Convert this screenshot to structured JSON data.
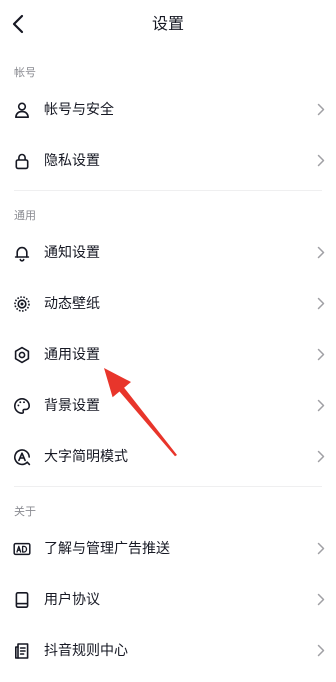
{
  "header": {
    "title": "设置",
    "back_icon": "chevron-left-icon"
  },
  "sections": [
    {
      "label": "帐号",
      "items": [
        {
          "label": "帐号与安全",
          "icon": "user-icon"
        },
        {
          "label": "隐私设置",
          "icon": "lock-icon"
        }
      ]
    },
    {
      "label": "通用",
      "items": [
        {
          "label": "通知设置",
          "icon": "bell-icon"
        },
        {
          "label": "动态壁纸",
          "icon": "live-wallpaper-icon"
        },
        {
          "label": "通用设置",
          "icon": "gear-icon"
        },
        {
          "label": "背景设置",
          "icon": "palette-icon"
        },
        {
          "label": "大字简明模式",
          "icon": "large-font-icon"
        }
      ]
    },
    {
      "label": "关于",
      "items": [
        {
          "label": "了解与管理广告推送",
          "icon": "ad-icon"
        },
        {
          "label": "用户协议",
          "icon": "book-icon"
        },
        {
          "label": "抖音规则中心",
          "icon": "document-icon"
        }
      ]
    }
  ],
  "colors": {
    "text": "#161823",
    "section_label": "#8a8b91",
    "chevron": "#a0a0a5",
    "divider": "#efeff0",
    "annotation_arrow": "#e8352b"
  }
}
